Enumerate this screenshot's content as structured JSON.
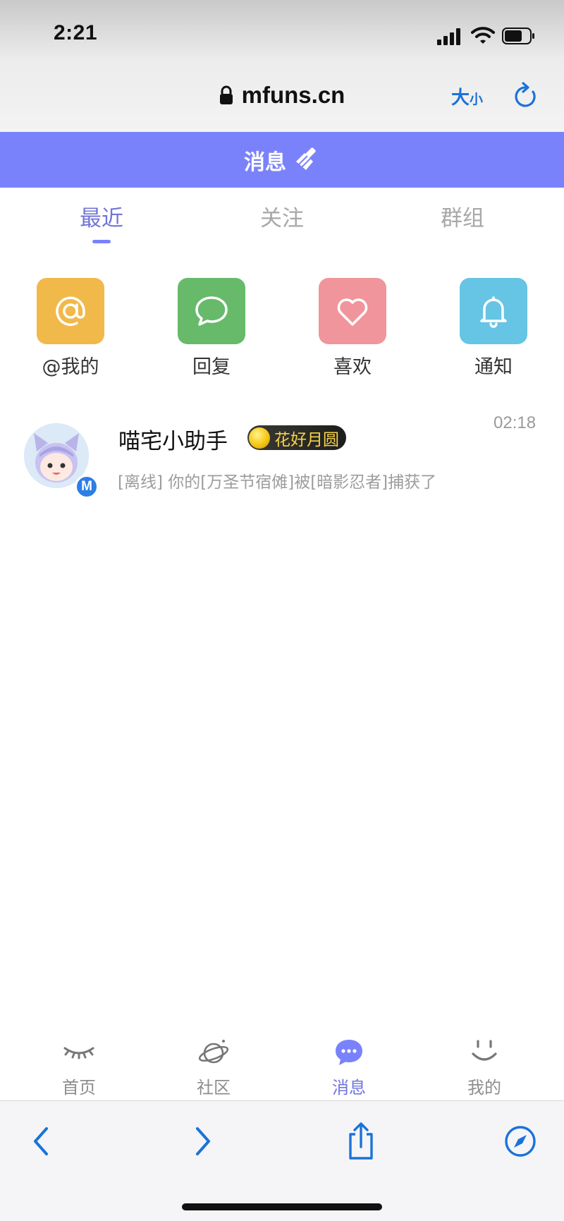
{
  "status_bar": {
    "time": "2:21"
  },
  "browser": {
    "url": "mfuns.cn",
    "text_size_large": "大",
    "text_size_small": "小"
  },
  "header": {
    "title": "消息"
  },
  "tabs": [
    {
      "label": "最近",
      "active": true
    },
    {
      "label": "关注",
      "active": false
    },
    {
      "label": "群组",
      "active": false
    }
  ],
  "quick_actions": [
    {
      "label": "@我的",
      "icon": "at-icon",
      "color": "#f1b94a"
    },
    {
      "label": "回复",
      "icon": "comment-icon",
      "color": "#66ba6a"
    },
    {
      "label": "喜欢",
      "icon": "heart-icon",
      "color": "#f0959c"
    },
    {
      "label": "通知",
      "icon": "bell-icon",
      "color": "#66c4e4"
    }
  ],
  "messages": [
    {
      "sender": "喵宅小助手",
      "badge_letter": "M",
      "medal": "花好月圆",
      "time": "02:18",
      "preview": "[离线] 你的[万圣节宿傩]被[暗影忍者]捕获了"
    }
  ],
  "bottom_nav": [
    {
      "label": "首页",
      "icon": "closed-eye-icon",
      "active": false
    },
    {
      "label": "社区",
      "icon": "planet-icon",
      "active": false
    },
    {
      "label": "消息",
      "icon": "chat-bubble-icon",
      "active": true
    },
    {
      "label": "我的",
      "icon": "smile-icon",
      "active": false
    }
  ],
  "colors": {
    "accent": "#7a82fb",
    "safari_blue": "#1a73d9"
  }
}
